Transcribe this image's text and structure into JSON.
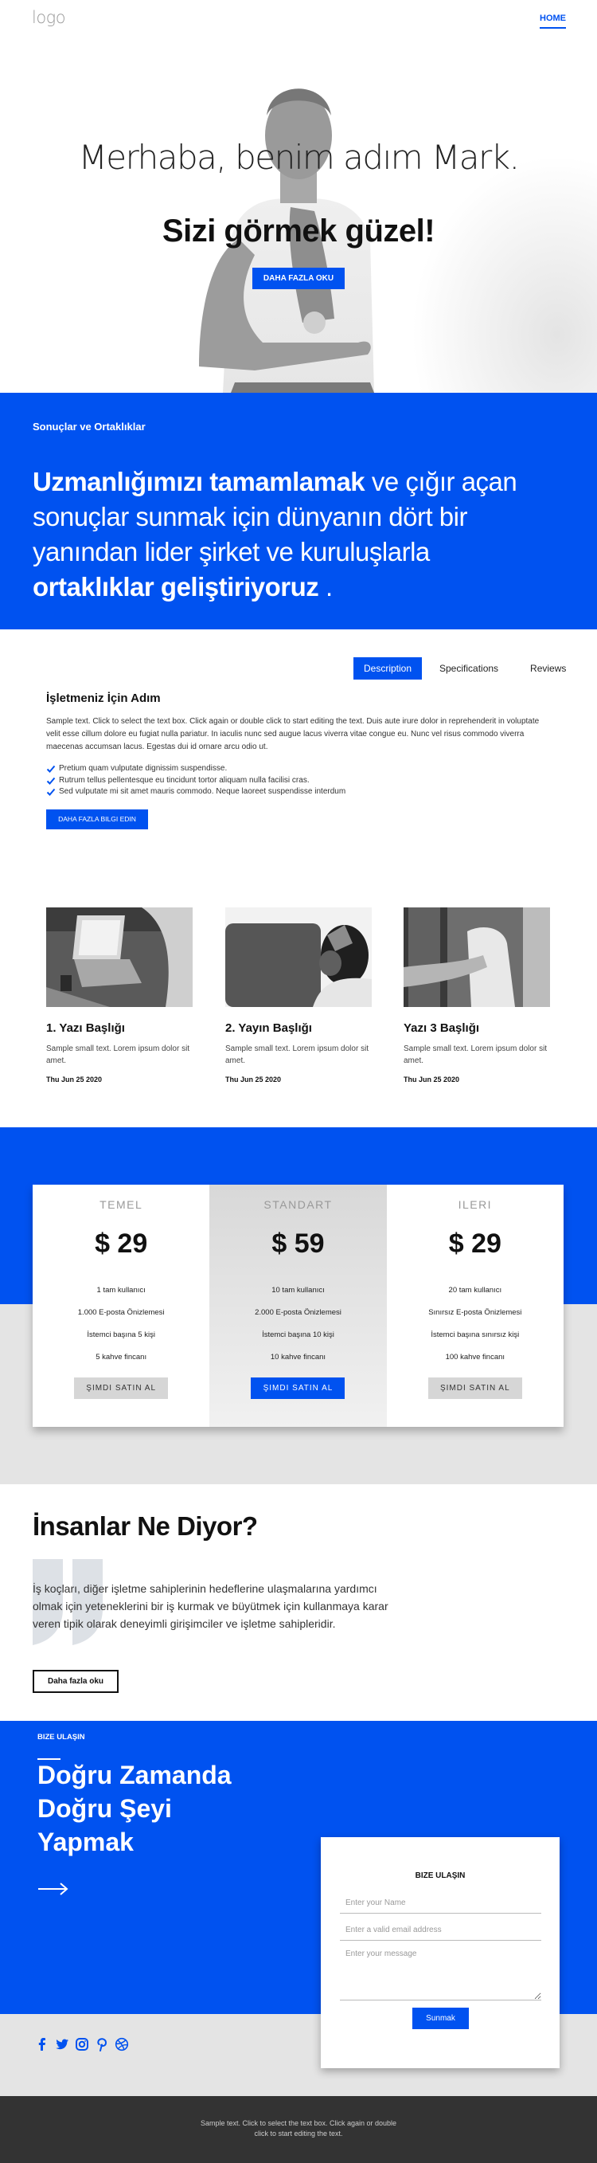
{
  "header": {
    "logo": "logo",
    "nav": [
      {
        "label": "HOME",
        "active": true
      }
    ]
  },
  "hero": {
    "title_light": "Merhaba, benim adım Mark.",
    "title_bold": "Sizi görmek güzel!",
    "button": "DAHA FAZLA OKU"
  },
  "intro": {
    "label": "Sonuçlar ve Ortaklıklar",
    "bold_1": "Uzmanlığımızı tamamlamak",
    "light_1": " ve çığır açan sonuçlar sunmak için dünyanın dört bir yanından lider şirket ve kuruluşlarla ",
    "bold_2": "ortaklıklar geliştiriyoruz",
    "light_2": " ."
  },
  "tabs": {
    "items": [
      {
        "label": "Description",
        "active": true
      },
      {
        "label": "Specifications",
        "active": false
      },
      {
        "label": "Reviews",
        "active": false
      }
    ],
    "title": "İşletmeniz İçin Adım",
    "body": "Sample text. Click to select the text box. Click again or double click to start editing the text. Duis aute irure dolor in reprehenderit in voluptate velit esse cillum dolore eu fugiat nulla pariatur. In iaculis nunc sed augue lacus viverra vitae congue eu. Nunc vel risus commodo viverra maecenas accumsan lacus. Egestas dui id ornare arcu odio ut.",
    "checklist": [
      "Pretium quam vulputate dignissim suspendisse.",
      "Rutrum tellus pellentesque eu tincidunt tortor aliquam nulla facilisi cras.",
      "Sed vulputate mi sit amet mauris commodo. Neque laoreet suspendisse interdum"
    ],
    "button": "DAHA FAZLA BILGI EDIN"
  },
  "posts": [
    {
      "title": "1. Yazı Başlığı",
      "text": "Sample small text. Lorem ipsum dolor sit amet.",
      "date": "Thu Jun 25 2020",
      "image": "laptop-meeting-photo"
    },
    {
      "title": "2. Yayın Başlığı",
      "text": "Sample small text. Lorem ipsum dolor sit amet.",
      "date": "Thu Jun 25 2020",
      "image": "vr-headset-photo"
    },
    {
      "title": "Yazı 3 Başlığı",
      "text": "Sample small text. Lorem ipsum dolor sit amet.",
      "date": "Thu Jun 25 2020",
      "image": "people-phone-photo"
    }
  ],
  "pricing": {
    "plans": [
      {
        "name": "TEMEL",
        "price": "$ 29",
        "features": [
          "1 tam kullanıcı",
          "1.000 E-posta Önizlemesi",
          "İstemci başına 5 kişi",
          "5 kahve fincanı"
        ],
        "button": "ŞIMDI SATIN AL",
        "featured": false
      },
      {
        "name": "STANDART",
        "price": "$ 59",
        "features": [
          "10 tam kullanıcı",
          "2.000 E-posta Önizlemesi",
          "İstemci başına 10 kişi",
          "10 kahve fincanı"
        ],
        "button": "ŞIMDI SATIN AL",
        "featured": true
      },
      {
        "name": "ILERI",
        "price": "$ 29",
        "features": [
          "20 tam kullanıcı",
          "Sınırsız E-posta Önizlemesi",
          "İstemci başına sınırsız kişi",
          "100 kahve fincanı"
        ],
        "button": "ŞIMDI SATIN AL",
        "featured": false
      }
    ]
  },
  "testimonial": {
    "title": "İnsanlar Ne Diyor?",
    "text": "İş koçları, diğer işletme sahiplerinin hedeflerine ulaşmalarına yardımcı olmak için yeteneklerini bir iş kurmak ve büyütmek için kullanmaya karar veren tipik olarak deneyimli girişimciler ve işletme sahipleridir.",
    "button": "Daha fazla oku"
  },
  "contact": {
    "label": "BIZE ULAŞIN",
    "heading": "Doğru Zamanda Doğru Şeyi Yapmak",
    "form": {
      "title": "BIZE ULAŞIN",
      "name_placeholder": "Enter your Name",
      "email_placeholder": "Enter a valid email address",
      "message_placeholder": "Enter your message",
      "submit": "Sunmak"
    },
    "socials": [
      "facebook",
      "twitter",
      "instagram",
      "pinterest",
      "dribbble"
    ]
  },
  "footer": {
    "text": "Sample text. Click to select the text box. Click again or double click to start editing the text."
  },
  "colors": {
    "accent": "#0052f0",
    "grey_band": "#e4e4e4",
    "footer": "#333333"
  }
}
